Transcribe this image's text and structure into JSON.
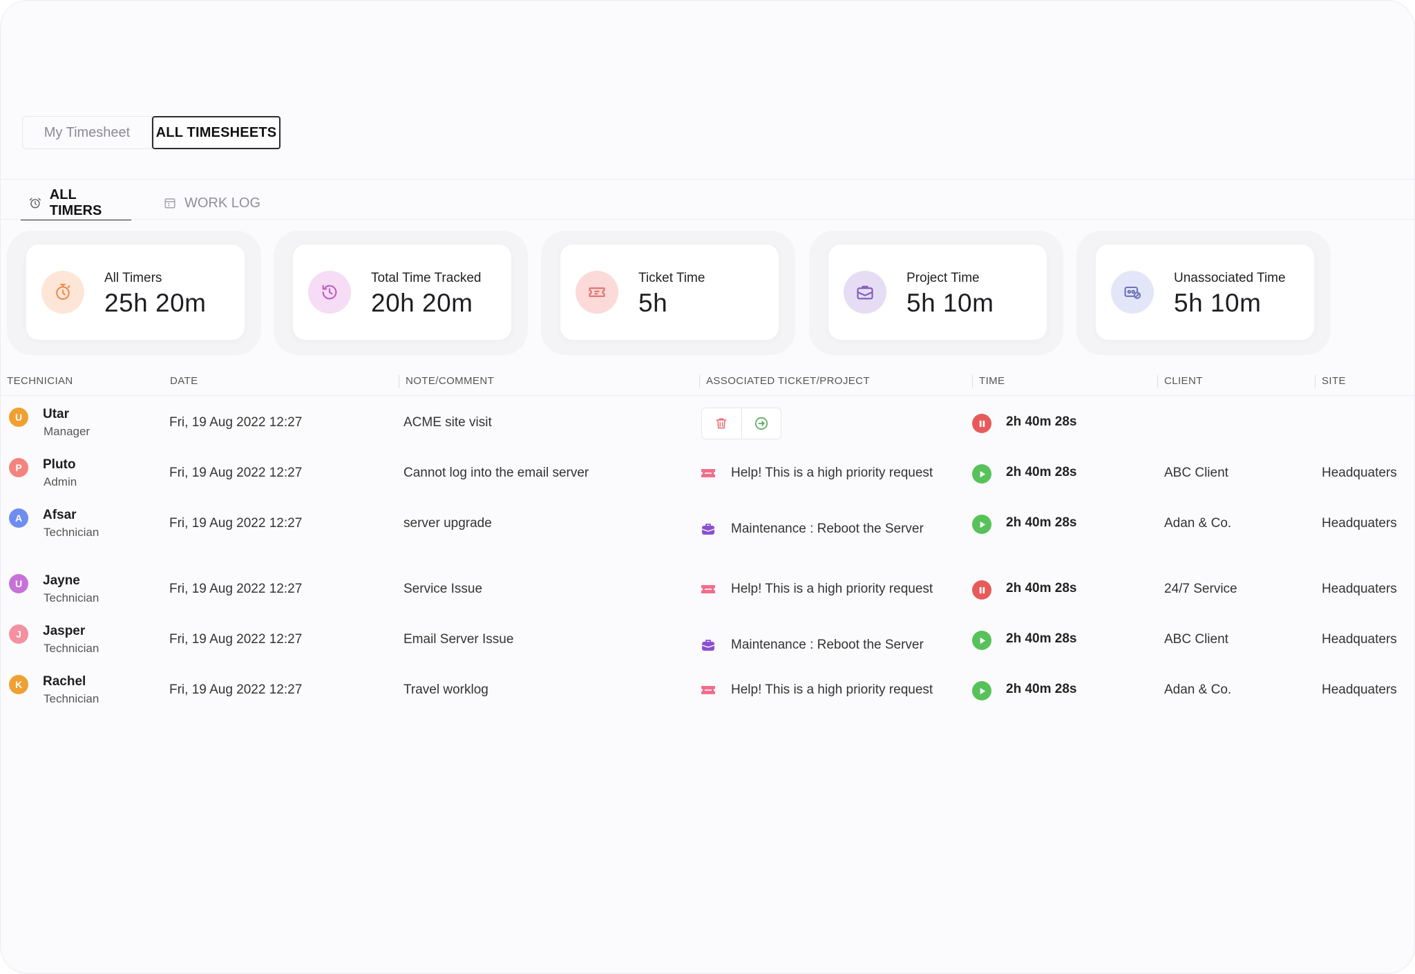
{
  "segmented": {
    "my_timesheet": "My Timesheet",
    "all_timesheets": "ALL TIMESHEETS"
  },
  "tabs": {
    "all_timers": "ALL TIMERS",
    "work_log": "WORK LOG"
  },
  "stats": [
    {
      "title": "All Timers",
      "value": "25h   20m",
      "icon": "stopwatch-icon",
      "bg": "#fde6d8",
      "color": "#f08a4b"
    },
    {
      "title": "Total Time Tracked",
      "value": "20h   20m",
      "icon": "history-icon",
      "bg": "#f6dcf5",
      "color": "#c05bbd"
    },
    {
      "title": "Ticket Time",
      "value": "5h",
      "icon": "ticket-icon",
      "bg": "#fbdad9",
      "color": "#e0706c"
    },
    {
      "title": "Project Time",
      "value": "5h   10m",
      "icon": "briefcase-icon",
      "bg": "#e6dcf4",
      "color": "#7d5bb5"
    },
    {
      "title": "Unassociated Time",
      "value": "5h   10m",
      "icon": "unlinked-icon",
      "bg": "#e2e6f8",
      "color": "#6b74b8"
    }
  ],
  "table": {
    "headers": [
      "TECHNICIAN",
      "DATE",
      "NOTE/COMMENT",
      "ASSOCIATED TICKET/PROJECT",
      "TIME",
      "CLIENT",
      "SITE"
    ],
    "rows": [
      {
        "initial": "U",
        "name": "Utar",
        "role": "Manager",
        "date": "Fri, 19 Aug 2022 12:27",
        "note": "ACME site visit",
        "assoc": "",
        "assoc_type": "actions",
        "status": "pause",
        "time": "2h 40m 28s",
        "client": "",
        "site": "",
        "avatar_color": "#f0a030"
      },
      {
        "initial": "P",
        "name": "Pluto",
        "role": "Admin",
        "date": "Fri, 19 Aug 2022 12:27",
        "note": "Cannot log into the email server",
        "assoc": "Help! This is a high priority request",
        "assoc_type": "ticket",
        "status": "play",
        "time": "2h 40m 28s",
        "client": "ABC Client",
        "site": "Headquaters",
        "avatar_color": "#f4837d"
      },
      {
        "initial": "A",
        "name": "Afsar",
        "role": "Technician",
        "date": "Fri, 19 Aug 2022 12:27",
        "note": "server upgrade",
        "assoc": "Maintenance : Reboot the Server",
        "assoc_type": "project",
        "status": "play",
        "time": "2h 40m 28s",
        "client": "Adan & Co.",
        "site": "Headquaters",
        "avatar_color": "#6f8df0"
      },
      {
        "initial": "U",
        "name": "Jayne",
        "role": "Technician",
        "date": "Fri, 19 Aug 2022 12:27",
        "note": "Service Issue",
        "assoc": "Help! This is a high priority request",
        "assoc_type": "ticket",
        "status": "pause",
        "time": "2h 40m 28s",
        "client": "24/7 Service",
        "site": "Headquaters",
        "avatar_color": "#c772d8"
      },
      {
        "initial": "J",
        "name": "Jasper",
        "role": "Technician",
        "date": "Fri, 19 Aug 2022 12:27",
        "note": "Email Server Issue",
        "assoc": "Maintenance : Reboot the Server",
        "assoc_type": "project",
        "status": "play",
        "time": "2h 40m 28s",
        "client": "ABC Client",
        "site": "Headquaters",
        "avatar_color": "#f490a0"
      },
      {
        "initial": "K",
        "name": "Rachel",
        "role": "Technician",
        "date": "Fri, 19 Aug 2022 12:27",
        "note": "Travel worklog",
        "assoc": "Help! This is a high priority request",
        "assoc_type": "ticket",
        "status": "play",
        "time": "2h 40m 28s",
        "client": "Adan & Co.",
        "site": "Headquaters",
        "avatar_color": "#f0a030"
      }
    ]
  },
  "colors": {
    "ticket": "#f26d8a",
    "project": "#8b4fd1",
    "pause": "#e85a5a",
    "play": "#57c25a"
  }
}
